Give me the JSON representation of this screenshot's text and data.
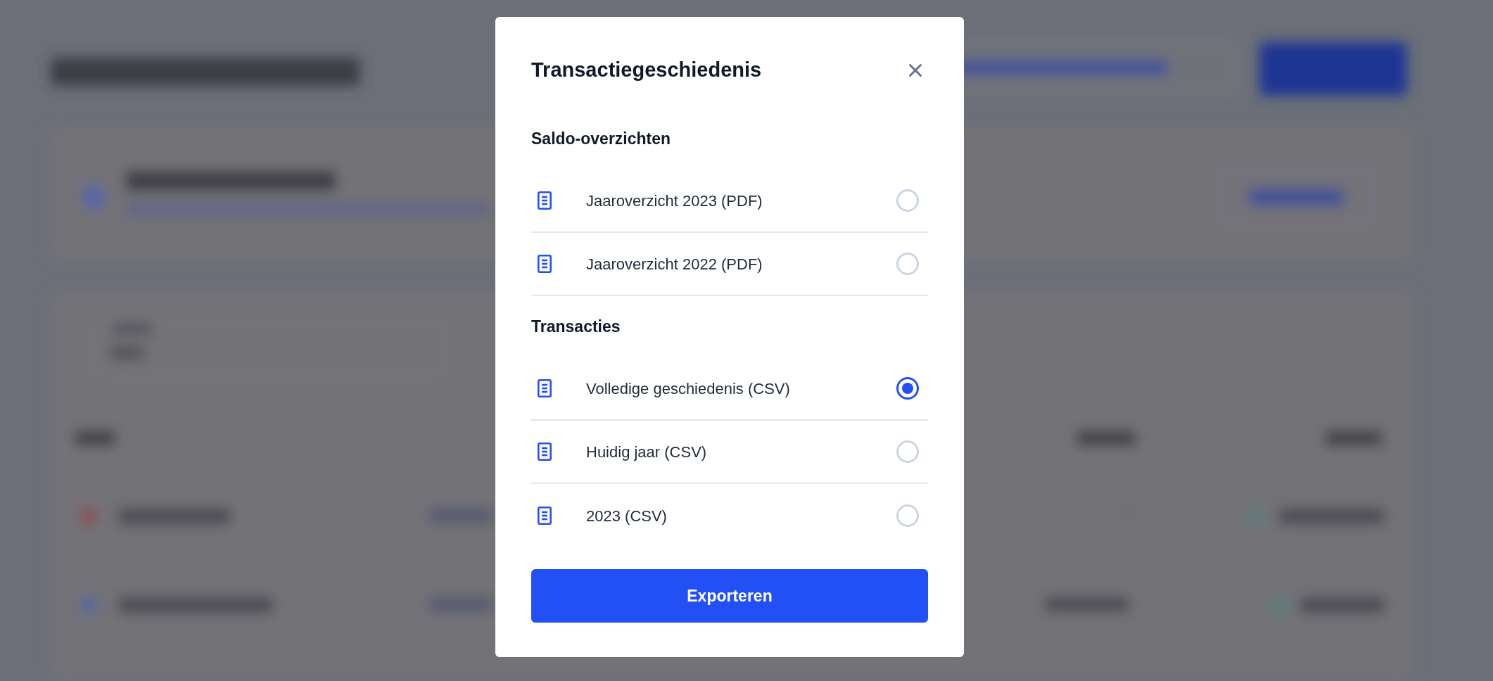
{
  "dialog": {
    "title": "Transactiegeschiedenis",
    "sections": [
      {
        "heading": "Saldo-overzichten",
        "options": [
          {
            "label": "Jaaroverzicht 2023 (PDF)",
            "selected": false
          },
          {
            "label": "Jaaroverzicht 2022 (PDF)",
            "selected": false
          }
        ]
      },
      {
        "heading": "Transacties",
        "options": [
          {
            "label": "Volledige geschiedenis (CSV)",
            "selected": true
          },
          {
            "label": "Huidig jaar (CSV)",
            "selected": false
          },
          {
            "label": "2023 (CSV)",
            "selected": false
          }
        ]
      }
    ],
    "button": "Exporteren"
  }
}
